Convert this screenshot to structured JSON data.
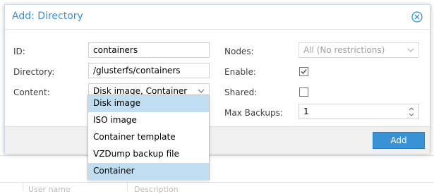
{
  "dialog": {
    "title": "Add: Directory",
    "add_button": "Add"
  },
  "form": {
    "id_label": "ID:",
    "id_value": "containers",
    "directory_label": "Directory:",
    "directory_value": "/glusterfs/containers",
    "content_label": "Content:",
    "content_value": "Disk image, Container",
    "nodes_label": "Nodes:",
    "nodes_value": "All (No restrictions)",
    "enable_label": "Enable:",
    "enable_checked": true,
    "shared_label": "Shared:",
    "shared_checked": false,
    "max_backups_label": "Max Backups:",
    "max_backups_value": "1"
  },
  "content_options": [
    {
      "label": "Disk image",
      "selected": true
    },
    {
      "label": "ISO image",
      "selected": false
    },
    {
      "label": "Container template",
      "selected": false
    },
    {
      "label": "VZDump backup file",
      "selected": false
    },
    {
      "label": "Container",
      "selected": true
    }
  ],
  "background": {
    "columns": [
      "User name",
      "Description"
    ]
  },
  "colors": {
    "accent": "#3892d4",
    "selected_item": "#c1ddf1"
  }
}
